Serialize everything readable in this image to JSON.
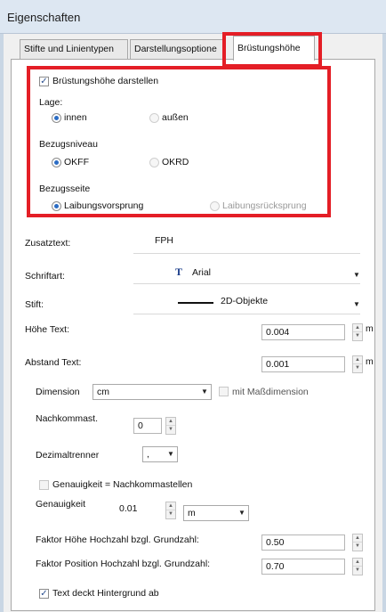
{
  "window": {
    "title": "Eigenschaften"
  },
  "tabs": [
    {
      "label": "Stifte und Linientypen"
    },
    {
      "label": "Darstellungsoptione"
    },
    {
      "label": "Brüstungshöhe"
    }
  ],
  "brh": {
    "show_label": "Brüstungshöhe darstellen",
    "lage_label": "Lage:",
    "lage_innen": "innen",
    "lage_aussen": "außen",
    "bezugsniveau_label": "Bezugsniveau",
    "niveau_okff": "OKFF",
    "niveau_okrd": "OKRD",
    "bezugsseite_label": "Bezugsseite",
    "seite_vor": "Laibungsvorsprung",
    "seite_rueck": "Laibungsrücksprung"
  },
  "form": {
    "zusatztext_label": "Zusatztext:",
    "zusatztext_value": "FPH",
    "schriftart_label": "Schriftart:",
    "schriftart_icon_glyph": "T",
    "schriftart_value": "Arial",
    "stift_label": "Stift:",
    "stift_value": "2D-Objekte",
    "hoehe_label": "Höhe Text:",
    "hoehe_value": "0.004",
    "hoehe_unit": "m",
    "abstand_label": "Abstand Text:",
    "abstand_value": "0.001",
    "abstand_unit": "m",
    "dimension_label": "Dimension",
    "dimension_value": "cm",
    "mass_label": "mit Maßdimension",
    "nachkomma_label": "Nachkommast.",
    "nachkomma_value": "0",
    "dezimal_label": "Dezimaltrenner",
    "dezimal_value": ",",
    "genau_cb_label": "Genauigkeit = Nachkommastellen",
    "genauigkeit_label": "Genauigkeit",
    "genauigkeit_value": "0.01",
    "genauigkeit_unit": "m",
    "faktor_hoehe_label": "Faktor Höhe Hochzahl bzgl. Grundzahl:",
    "faktor_hoehe_value": "0.50",
    "faktor_pos_label": "Faktor Position Hochzahl bzgl. Grundzahl:",
    "faktor_pos_value": "0.70",
    "text_deckt_label": "Text deckt Hintergrund ab"
  },
  "icons": {
    "checkmark": "✓",
    "spin_up": "▲",
    "spin_down": "▼",
    "dropdown": "▼"
  },
  "colors": {
    "highlight": "#e41e26",
    "radio_selected": "#2b6cc4",
    "titlebar": "#dde7f2"
  }
}
